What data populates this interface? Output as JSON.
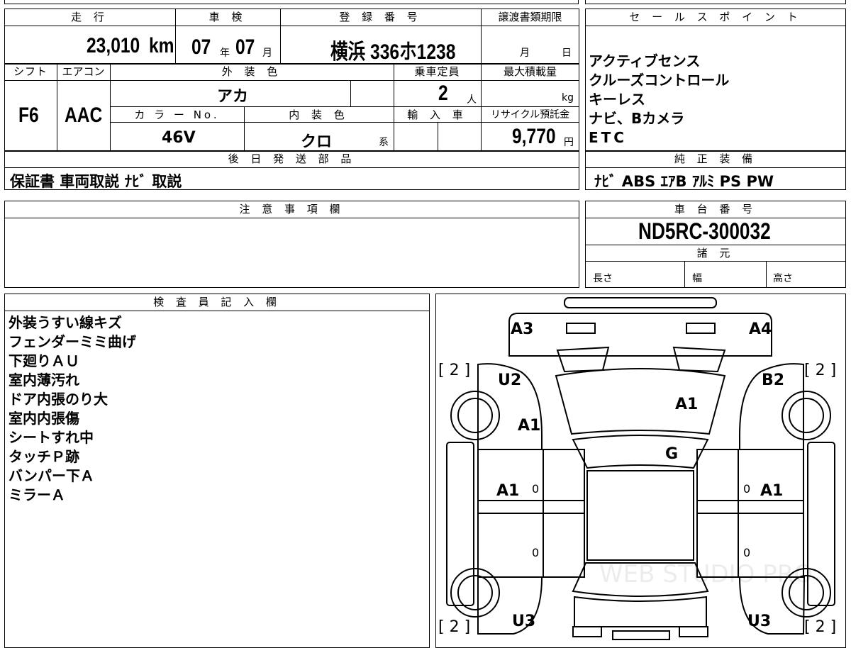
{
  "top_table": {
    "mileage_header": "走 行",
    "mileage_value": "23,010",
    "mileage_unit": "km",
    "inspection_header": "車 検",
    "inspection_year": "07",
    "inspection_year_unit": "年",
    "inspection_month": "07",
    "inspection_month_unit": "月",
    "registration_header": "登 録 番 号",
    "registration_value": "横浜 336ホ1238",
    "transfer_header": "譲渡書類期限",
    "transfer_month_unit": "月",
    "transfer_day_unit": "日",
    "shift_header": "シフト",
    "shift_value": "F6",
    "ac_header": "エアコン",
    "ac_value": "AAC",
    "exterior_header": "外 装 色",
    "exterior_value": "アカ",
    "capacity_header": "乗車定員",
    "capacity_value": "2",
    "capacity_unit": "人",
    "maxload_header": "最大積載量",
    "maxload_unit": "kg",
    "color_no_header": "カ ラ ー No.",
    "color_no_value": "46V",
    "interior_header": "内 装 色",
    "interior_value": "クロ",
    "interior_unit": "系",
    "import_header": "輸 入 車",
    "recycle_header": "リサイクル預託金",
    "recycle_value": "9,770",
    "recycle_unit": "円",
    "later_parts_header": "後 日 発 送 部 品",
    "later_parts_value": "保証書  車両取説  ﾅﾋﾞ 取説"
  },
  "sales_points": {
    "header": "セ ー ル ス ポ イ ン ト",
    "items": [
      "アクティブセンス",
      "クルーズコントロール",
      "キーレス",
      "ナビ、Bカメラ",
      "ETC"
    ]
  },
  "genuine_equipment": {
    "header": "純 正 装 備",
    "value": "ﾅﾋﾞ  ABS  ｴｱB  ｱﾙﾐ  PS  PW"
  },
  "notes": {
    "header": "注 意 事 項 欄"
  },
  "chassis": {
    "header": "車 台 番 号",
    "value": "ND5RC-300032"
  },
  "specs": {
    "header": "諸 元",
    "length": "長さ",
    "width": "幅",
    "height": "高さ"
  },
  "inspector": {
    "header": "検 査 員 記 入 欄",
    "lines": [
      "外装うすい線キズ",
      "フェンダーミミ曲げ",
      "下廻りＡＵ",
      "室内薄汚れ",
      "ドア内張のり大",
      "室内内張傷",
      "シートすれ中",
      "タッチＰ跡",
      "バンパー下Ａ",
      "ミラーＡ"
    ]
  },
  "diagram": {
    "labels": {
      "a3": "A3",
      "a4": "A4",
      "u2": "U2",
      "b2": "B2",
      "a1_hood": "A1",
      "a1_left_fender": "A1",
      "g": "G",
      "a1_left_door": "A1",
      "a1_right_door": "A1",
      "u3_left": "U3",
      "u3_right": "U3"
    },
    "tire_marks": [
      "[ 2 ]",
      "[ 2 ]",
      "[ 2 ]",
      "[ 2 ]"
    ],
    "zeros": [
      "0",
      "0",
      "0",
      "0"
    ],
    "watermark": "WEB STUDIO PRO"
  }
}
